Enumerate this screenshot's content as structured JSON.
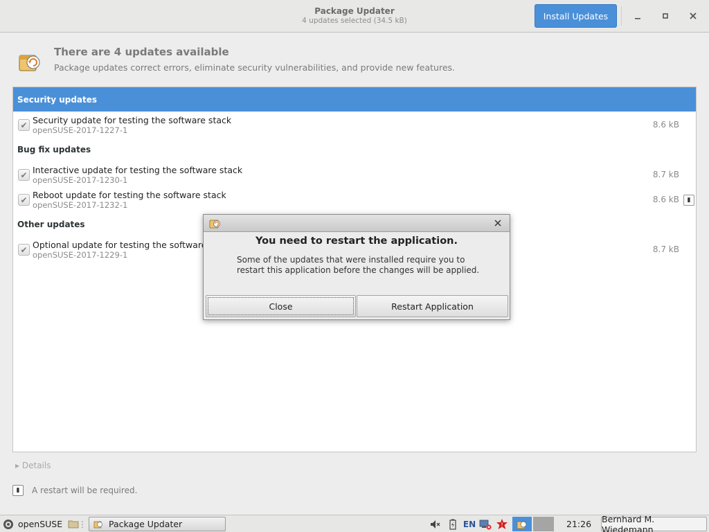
{
  "window": {
    "title": "Package Updater",
    "subtitle": "4 updates selected (34.5 kB)",
    "install_button": "Install Updates",
    "minimize_icon": "minimize-icon",
    "maximize_icon": "maximize-icon",
    "close_icon": "close-icon"
  },
  "info": {
    "icon": "package-update-icon",
    "title": "There are 4 updates available",
    "subtitle": "Package updates correct errors, eliminate security vulnerabilities, and provide new features."
  },
  "groups": [
    {
      "label": "Security updates",
      "selected": true,
      "items": [
        {
          "title": "Security update for testing the software stack",
          "id": "openSUSE-2017-1227-1",
          "size": "8.6 kB",
          "checked": true
        }
      ]
    },
    {
      "label": "Bug fix updates",
      "selected": false,
      "items": [
        {
          "title": "Interactive update for testing the software stack",
          "id": "openSUSE-2017-1230-1",
          "size": "8.7 kB",
          "checked": true
        },
        {
          "title": "Reboot update for testing the software stack",
          "id": "openSUSE-2017-1232-1",
          "size": "8.6 kB",
          "checked": true,
          "badge": "restart-required-icon"
        }
      ]
    },
    {
      "label": "Other updates",
      "selected": false,
      "items": [
        {
          "title": "Optional update for testing the software sta",
          "id": "openSUSE-2017-1229-1",
          "size": "8.7 kB",
          "checked": true
        }
      ]
    }
  ],
  "details": {
    "label": "Details"
  },
  "footer": {
    "text": "A restart will be required.",
    "icon": "restart-required-icon"
  },
  "dialog": {
    "title": "You need to restart the application.",
    "message": "Some of the updates that were installed require you to restart this application before the changes will be applied.",
    "close_button": "Close",
    "restart_button": "Restart Application"
  },
  "taskbar": {
    "start_label": "openSUSE",
    "window_label": "Package Updater",
    "keyboard_layout": "EN",
    "clock": "21:26",
    "user": "Bernhard M. Wiedemann"
  },
  "colors": {
    "accent": "#4a90d9",
    "headerbar": "#e8e8e7",
    "background": "#ededed"
  }
}
